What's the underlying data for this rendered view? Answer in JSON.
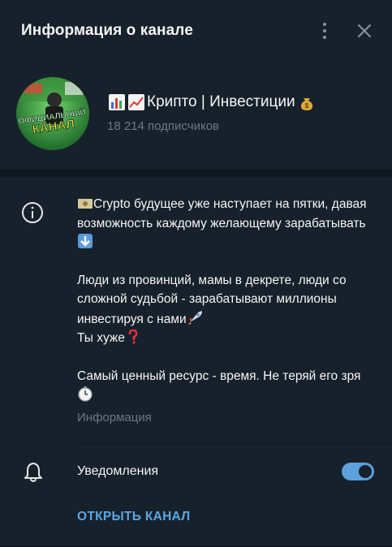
{
  "header": {
    "title": "Информация о канале"
  },
  "channel": {
    "name": "Крипто | Инвестиции",
    "subscribers": "18 214 подписчиков",
    "avatar_text_1": "ОФИЦИАЛЬНЫЙ",
    "avatar_text_2": "КАНАЛ"
  },
  "description": {
    "p1_part1": "Crypto будущее уже наступает на пятки, давая возможность каждому желающему зарабатывать",
    "p2_part1": "Люди из провинций, мамы в декрете, люди со сложной судьбой - зарабатывают миллионы инвестируя с нами",
    "p3_part1": "Ты хуже",
    "p4_part1": "Самый ценный ресурс - время. Не теряй его зря",
    "caption": "Информация"
  },
  "notifications": {
    "label": "Уведомления",
    "enabled": true
  },
  "actions": {
    "open_channel": "ОТКРЫТЬ КАНАЛ"
  },
  "colors": {
    "background": "#17212b",
    "accent": "#5ca0dc",
    "muted": "#6d7883",
    "link": "#5aa7e4"
  },
  "icons": [
    "more-vertical-icon",
    "close-icon",
    "info-icon",
    "bell-icon",
    "bar-chart-emoji-icon",
    "chart-up-emoji-icon",
    "money-bag-emoji-icon",
    "money-banknote-emoji-icon",
    "down-arrow-emoji-icon",
    "rocket-emoji-icon",
    "red-question-emoji-icon",
    "stopwatch-emoji-icon"
  ]
}
